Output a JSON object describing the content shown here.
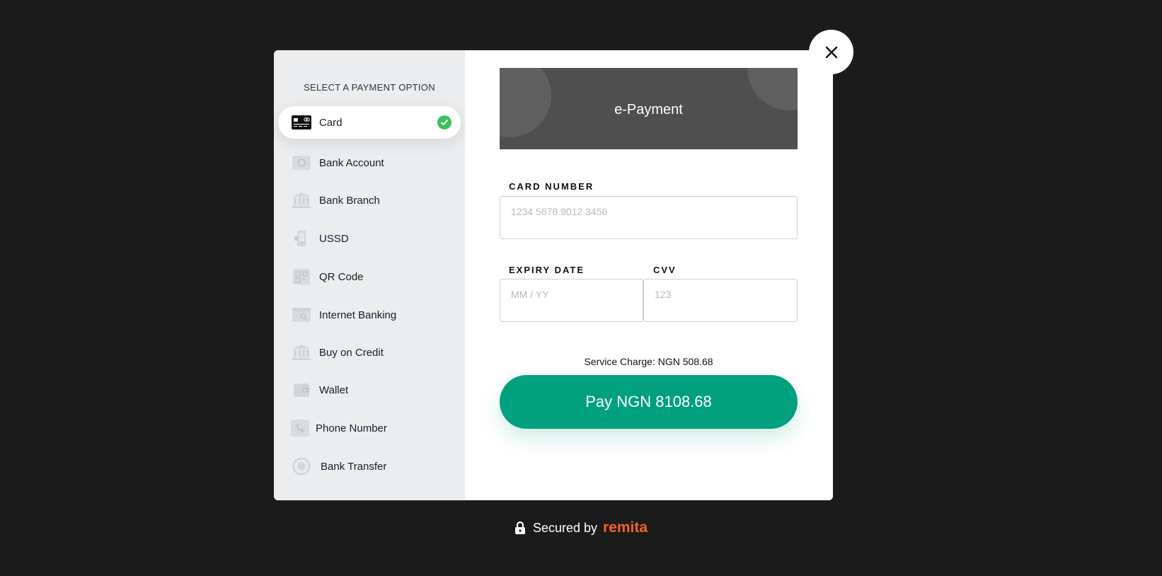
{
  "sidebar": {
    "title": "SELECT A PAYMENT OPTION",
    "options": [
      {
        "label": "Card",
        "icon": "credit-card-icon"
      },
      {
        "label": "Bank Account",
        "icon": "bank-account-icon"
      },
      {
        "label": "Bank Branch",
        "icon": "bank-building-icon"
      },
      {
        "label": "USSD",
        "icon": "mobile-phone-icon"
      },
      {
        "label": "QR Code",
        "icon": "qr-code-icon"
      },
      {
        "label": "Internet Banking",
        "icon": "internet-banking-icon"
      },
      {
        "label": "Buy on Credit",
        "icon": "bank-building-icon"
      },
      {
        "label": "Wallet",
        "icon": "wallet-icon"
      },
      {
        "label": "Phone Number",
        "icon": "phone-icon"
      },
      {
        "label": "Bank Transfer",
        "icon": "bank-transfer-icon"
      }
    ],
    "selected": "Card"
  },
  "banner": {
    "title": "e-Payment"
  },
  "form": {
    "card_number_label": "CARD NUMBER",
    "card_number_placeholder": "1234 5678 9012 3456",
    "expiry_label": "EXPIRY DATE",
    "expiry_placeholder": "MM / YY",
    "cvv_label": "CVV",
    "cvv_placeholder": "123"
  },
  "service_charge": "Service Charge: NGN 508.68",
  "pay_button": "Pay NGN 8108.68",
  "footer": {
    "secured_by": "Secured by",
    "brand": "remita"
  },
  "colors": {
    "accent": "#00a07e",
    "brand": "#f26522",
    "success": "#3cc15c",
    "backdrop": "#1b1b1b"
  }
}
